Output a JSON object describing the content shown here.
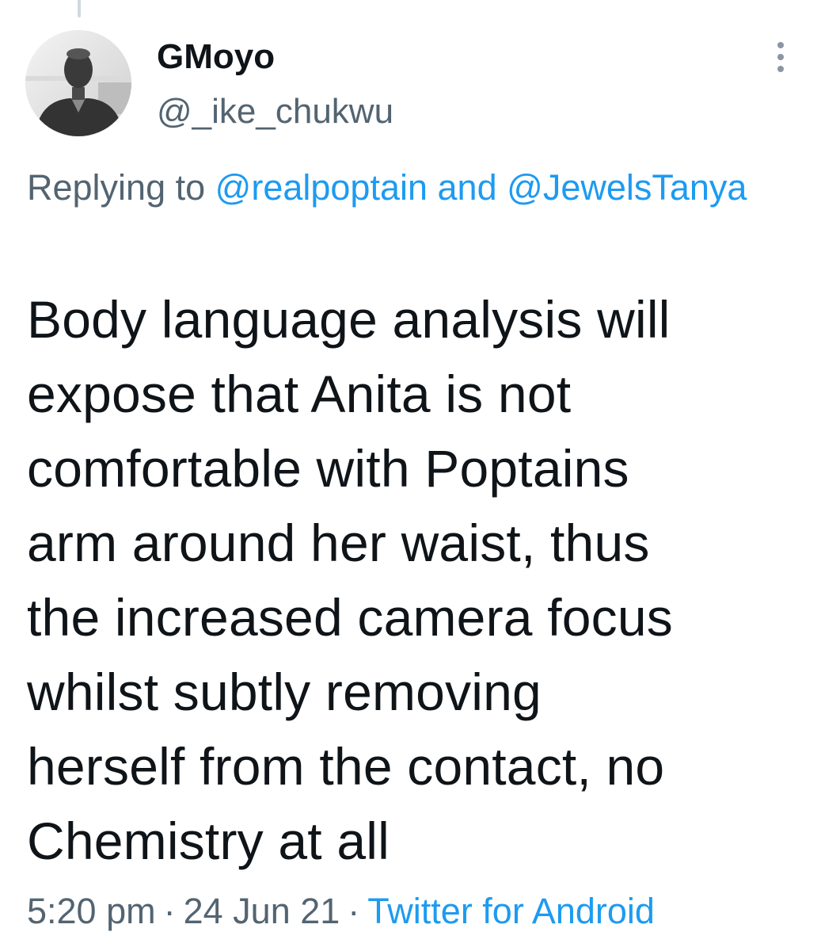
{
  "tweet": {
    "author": {
      "display_name": "GMoyo",
      "handle": "@_ike_chukwu"
    },
    "more_icon": "more-vertical-icon",
    "replying": {
      "prefix": "Replying to",
      "mention_1": "@realpoptain",
      "conjunction": "and",
      "mention_2": "@JewelsTanya"
    },
    "text": "Body language analysis will\nexpose that Anita is not\ncomfortable with Poptains\narm around her waist, thus\nthe increased camera focus\nwhilst subtly removing\nherself from the contact, no\nChemistry at all",
    "meta": {
      "time": "5:20 pm",
      "separator": "·",
      "date": "24 Jun 21",
      "source": "Twitter for Android"
    }
  },
  "colors": {
    "text_primary": "#0f1419",
    "text_secondary": "#536471",
    "link": "#1d9bf0"
  }
}
